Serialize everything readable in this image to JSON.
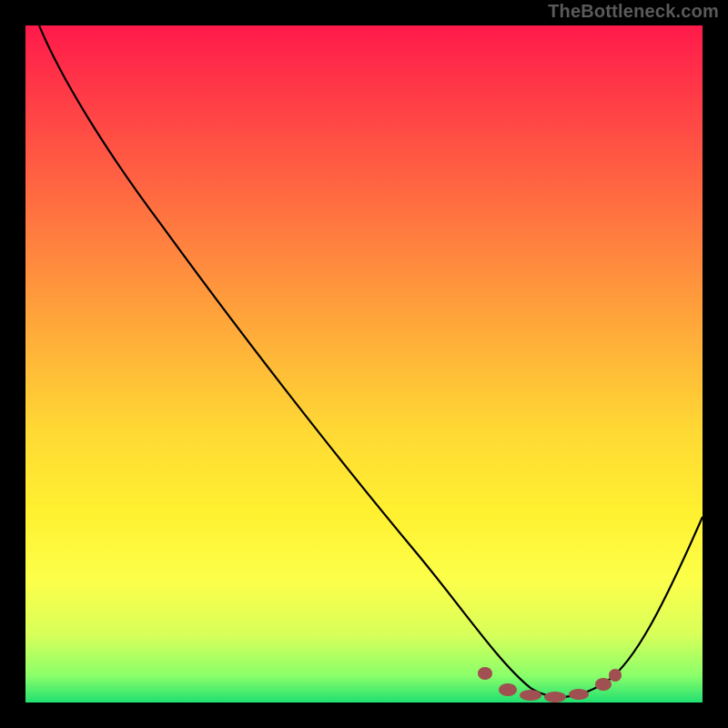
{
  "watermark": "TheBottleneck.com",
  "chart_data": {
    "type": "line",
    "title": "",
    "xlabel": "",
    "ylabel": "",
    "xlim": [
      0,
      100
    ],
    "ylim": [
      0,
      100
    ],
    "series": [
      {
        "name": "curve",
        "x": [
          2,
          8,
          20,
          35,
          50,
          62,
          67,
          74,
          80,
          86,
          90,
          100
        ],
        "y": [
          100,
          92,
          76,
          56,
          36,
          18,
          8,
          1,
          0.5,
          1.5,
          7,
          30
        ]
      }
    ],
    "markers": {
      "name": "highlight-band",
      "x": [
        67,
        72,
        76,
        80,
        84,
        86
      ],
      "y": [
        5,
        2,
        1.2,
        1,
        1.5,
        3
      ]
    },
    "gradient_stops": [
      {
        "pos": 0,
        "color": "#ff1a4b"
      },
      {
        "pos": 35,
        "color": "#ff8a3e"
      },
      {
        "pos": 72,
        "color": "#fff130"
      },
      {
        "pos": 96,
        "color": "#8bff6a"
      },
      {
        "pos": 100,
        "color": "#20e070"
      }
    ]
  }
}
